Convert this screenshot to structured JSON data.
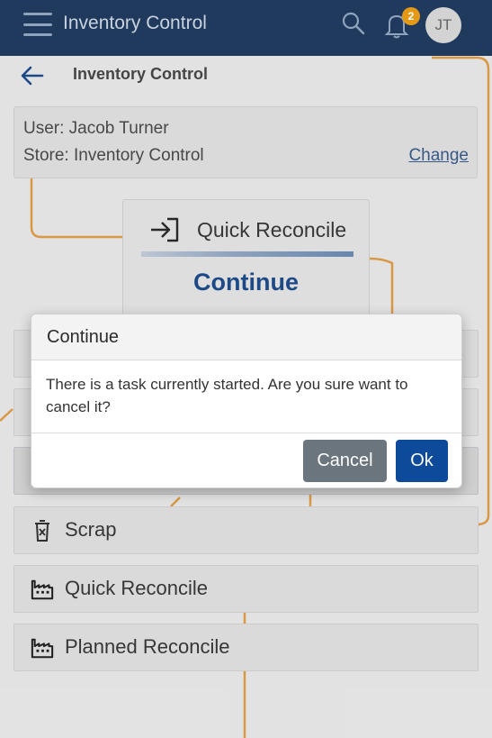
{
  "topbar": {
    "title": "Inventory Control",
    "notification_count": "2",
    "avatar_initials": "JT"
  },
  "subheader": {
    "title": "Inventory Control"
  },
  "info": {
    "user": "User: Jacob Turner",
    "store": "Store: Inventory Control",
    "change_label": "Change"
  },
  "quick_card": {
    "label": "Quick Reconcile",
    "continue_label": "Continue"
  },
  "menu": {
    "items": [
      {
        "label": "Scrap",
        "icon": "trash-icon"
      },
      {
        "label": "Quick Reconcile",
        "icon": "factory-icon"
      },
      {
        "label": "Planned Reconcile",
        "icon": "factory-icon"
      }
    ]
  },
  "dialog": {
    "title": "Continue",
    "message": "There is a task currently started. Are you sure want to cancel it?",
    "cancel_label": "Cancel",
    "ok_label": "Ok"
  },
  "colors": {
    "topbar": "#1f3a5c",
    "accent": "#0d4a9a",
    "badge": "#e59a17",
    "background_lines": "#e7a24a"
  }
}
